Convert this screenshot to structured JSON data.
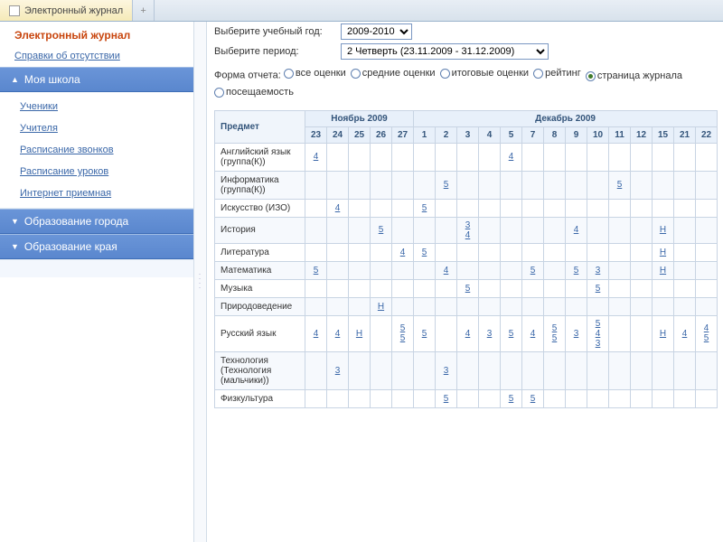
{
  "tab": {
    "title": "Электронный журнал",
    "add": "+"
  },
  "sidebar": {
    "title": "Электронный журнал",
    "absence": "Справки об отсутствии",
    "sections": [
      {
        "label": "Моя школа",
        "open": true,
        "items": [
          "Ученики",
          "Учителя",
          "Расписание звонков",
          "Расписание уроков",
          "Интернет приемная"
        ]
      },
      {
        "label": "Образование города",
        "open": false,
        "items": []
      },
      {
        "label": "Образование края",
        "open": false,
        "items": []
      }
    ]
  },
  "controls": {
    "yearLabel": "Выберите учебный год:",
    "yearValue": "2009-2010",
    "periodLabel": "Выберите период:",
    "periodValue": "2 Четверть (23.11.2009 - 31.12.2009)",
    "reportLabel": "Форма отчета:",
    "options": [
      "все оценки",
      "средние оценки",
      "итоговые оценки",
      "рейтинг",
      "страница журнала",
      "посещаемость"
    ],
    "selected": 4
  },
  "table": {
    "subjectHeader": "Предмет",
    "months": [
      {
        "label": "Ноябрь 2009",
        "span": 5
      },
      {
        "label": "Декабрь 2009",
        "span": 14
      }
    ],
    "days": [
      "23",
      "24",
      "25",
      "26",
      "27",
      "1",
      "2",
      "3",
      "4",
      "5",
      "7",
      "8",
      "9",
      "10",
      "11",
      "12",
      "15",
      "21",
      "22"
    ],
    "rows": [
      {
        "subject": "Английский язык (группа(К))",
        "cells": {
          "0": [
            "4"
          ],
          "9": [
            "4"
          ]
        }
      },
      {
        "subject": "Информатика (группа(К))",
        "cells": {
          "6": [
            "5"
          ],
          "14": [
            "5"
          ]
        }
      },
      {
        "subject": "Искусство (ИЗО)",
        "cells": {
          "1": [
            "4"
          ],
          "5": [
            "5"
          ]
        }
      },
      {
        "subject": "История",
        "cells": {
          "3": [
            "5"
          ],
          "7": [
            "3",
            "4"
          ],
          "12": [
            "4"
          ],
          "16": [
            "Н"
          ]
        }
      },
      {
        "subject": "Литература",
        "cells": {
          "4": [
            "4"
          ],
          "5": [
            "5"
          ],
          "16": [
            "Н"
          ]
        }
      },
      {
        "subject": "Математика",
        "cells": {
          "0": [
            "5"
          ],
          "6": [
            "4"
          ],
          "10": [
            "5"
          ],
          "12": [
            "5"
          ],
          "13": [
            "3"
          ],
          "16": [
            "Н"
          ]
        }
      },
      {
        "subject": "Музыка",
        "cells": {
          "7": [
            "5"
          ],
          "13": [
            "5"
          ]
        }
      },
      {
        "subject": "Природоведение",
        "cells": {
          "3": [
            "Н"
          ]
        }
      },
      {
        "subject": "Русский язык",
        "cells": {
          "0": [
            "4"
          ],
          "1": [
            "4"
          ],
          "2": [
            "Н"
          ],
          "4": [
            "5",
            "5"
          ],
          "5": [
            "5"
          ],
          "7": [
            "4"
          ],
          "8": [
            "3"
          ],
          "9": [
            "5"
          ],
          "10": [
            "4"
          ],
          "11": [
            "5",
            "5"
          ],
          "12": [
            "3"
          ],
          "13": [
            "5",
            "4",
            "3"
          ],
          "16": [
            "Н"
          ],
          "17": [
            "4"
          ],
          "18": [
            "4",
            "5"
          ]
        }
      },
      {
        "subject": "Технология (Технология (мальчики))",
        "cells": {
          "1": [
            "3"
          ],
          "6": [
            "3"
          ]
        }
      },
      {
        "subject": "Физкультура",
        "cells": {
          "6": [
            "5"
          ],
          "9": [
            "5"
          ],
          "10": [
            "5"
          ]
        }
      }
    ]
  }
}
